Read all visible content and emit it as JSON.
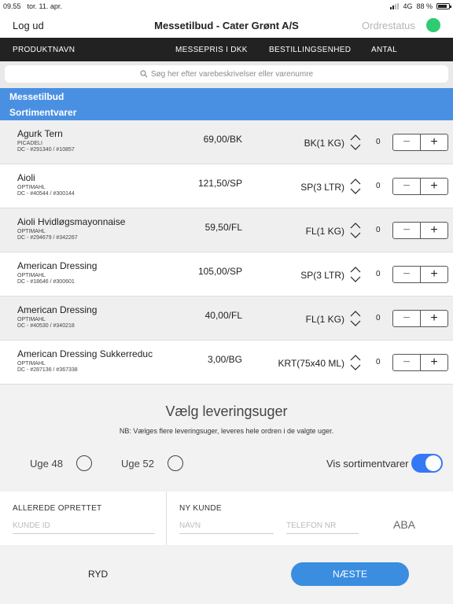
{
  "status_bar": {
    "time": "09.55",
    "date": "tor. 11. apr.",
    "network": "4G",
    "battery": "88 %",
    "battery_level": 0.88
  },
  "nav": {
    "logout": "Log ud",
    "title": "Messetilbud - Cater Grønt A/S",
    "order_status": "Ordrestatus",
    "status_color": "#2ecc71"
  },
  "columns": {
    "product": "PRODUKTNAVN",
    "price": "MESSEPRIS I DKK",
    "unit": "BESTILLINGSENHED",
    "qty": "ANTAL"
  },
  "search": {
    "placeholder": "Søg her efter varebeskrivelser eller varenumre",
    "icon": "search-icon"
  },
  "sections": {
    "offer": "Messetilbud",
    "assortment": "Sortimentvarer"
  },
  "products": [
    {
      "name": "Agurk Tern",
      "brand": "PICADELI",
      "dc": "DC - #291340 / #10857",
      "price": "69,00/BK",
      "unit": "BK(1 KG)",
      "qty": "0"
    },
    {
      "name": "Aioli",
      "brand": "OPTIMAHL",
      "dc": "DC - #40544 / #300144",
      "price": "121,50/SP",
      "unit": "SP(3 LTR)",
      "qty": "0"
    },
    {
      "name": "Aioli Hvidløgsmayonnaise",
      "brand": "OPTIMAHL",
      "dc": "DC - #294679 / #342267",
      "price": "59,50/FL",
      "unit": "FL(1 KG)",
      "qty": "0"
    },
    {
      "name": "American Dressing",
      "brand": "OPTIMAHL",
      "dc": "DC - #18646 / #300601",
      "price": "105,00/SP",
      "unit": "SP(3 LTR)",
      "qty": "0"
    },
    {
      "name": "American Dressing",
      "brand": "OPTIMAHL",
      "dc": "DC - #40530 / #340218",
      "price": "40,00/FL",
      "unit": "FL(1 KG)",
      "qty": "0"
    },
    {
      "name": "American Dressing Sukkerreduc",
      "brand": "OPTIMAHL",
      "dc": "DC - #287136 / #367338",
      "price": "3,00/BG",
      "unit": "KRT(75x40 ML)",
      "qty": "0"
    }
  ],
  "stepper": {
    "minus": "−",
    "plus": "+"
  },
  "delivery": {
    "title": "Vælg leveringsuger",
    "note": "NB: Vælges flere leveringsuger, leveres hele ordren i de valgte uger.",
    "week1": "Uge 48",
    "week2": "Uge 52",
    "show_assortment": "Vis sortimentvarer",
    "show_assortment_on": true
  },
  "customer": {
    "existing_head": "ALLEREDE OPRETTET",
    "customer_id_placeholder": "KUNDE ID",
    "new_head": "NY KUNDE",
    "name_placeholder": "NAVN",
    "phone_placeholder": "TELEFON NR",
    "aba": "ABA"
  },
  "footer": {
    "clear": "RYD",
    "next": "NÆSTE"
  }
}
